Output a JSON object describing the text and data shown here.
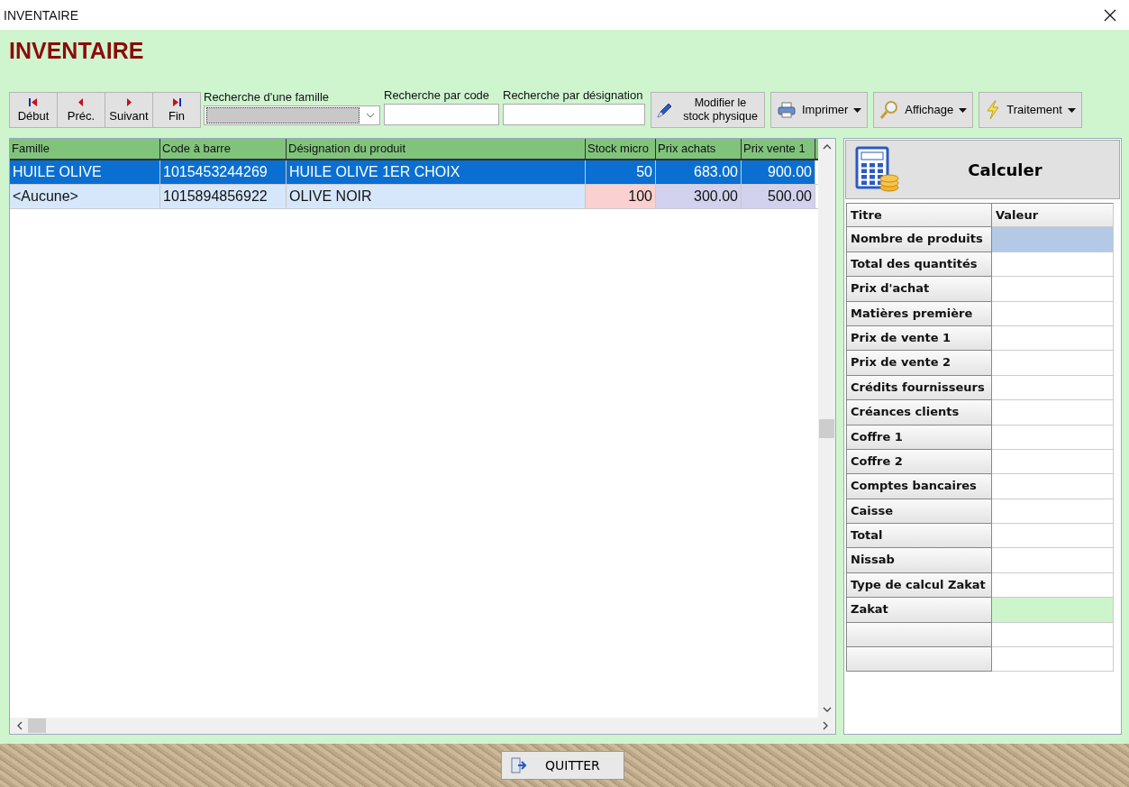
{
  "window": {
    "title": "INVENTAIRE"
  },
  "heading": "INVENTAIRE",
  "nav_buttons": [
    {
      "kind": "first",
      "label": "Début"
    },
    {
      "kind": "prev",
      "label": "Préc."
    },
    {
      "kind": "next",
      "label": "Suivant"
    },
    {
      "kind": "last",
      "label": "Fin"
    }
  ],
  "search": {
    "family_label": "Recherche d'une famille",
    "code_label": "Recherche par code",
    "designation_label": "Recherche par désignation"
  },
  "actions": [
    {
      "kind": "pen",
      "label": "Modifier le stock physique",
      "dropdown": false
    },
    {
      "kind": "printer",
      "label": "Imprimer",
      "dropdown": true
    },
    {
      "kind": "magnifier",
      "label": "Affichage",
      "dropdown": true
    },
    {
      "kind": "bolt",
      "label": "Traitement",
      "dropdown": true
    }
  ],
  "table": {
    "columns": [
      "Famille",
      "Code à barre",
      "Désignation du produit",
      "Stock micro",
      "Prix achats",
      "Prix vente 1"
    ],
    "rows": [
      {
        "selected": true,
        "cells": [
          "HUILE OLIVE",
          "1015453244269",
          "HUILE OLIVE 1ER CHOIX",
          "50",
          "683.00",
          "900.00"
        ]
      },
      {
        "selected": false,
        "cells": [
          "<Aucune>",
          "1015894856922",
          "OLIVE NOIR",
          "100",
          "300.00",
          "500.00"
        ]
      }
    ]
  },
  "calculate_button": "Calculer",
  "summary": {
    "columns": [
      "Titre",
      "Valeur"
    ],
    "rows": [
      {
        "title": "Nombre de produits",
        "color": "#b3c9e6"
      },
      {
        "title": "Total des quantités",
        "color": "#ffffff"
      },
      {
        "title": "Prix d'achat",
        "color": "#ffffff"
      },
      {
        "title": "Matières première",
        "color": "#ffffff"
      },
      {
        "title": "Prix de vente 1",
        "color": "#ffffff"
      },
      {
        "title": "Prix de vente 2",
        "color": "#ffffff"
      },
      {
        "title": "Crédits fournisseurs",
        "color": "#ffffff"
      },
      {
        "title": "Créances clients",
        "color": "#ffffff"
      },
      {
        "title": "Coffre 1",
        "color": "#ffffff"
      },
      {
        "title": "Coffre 2",
        "color": "#ffffff"
      },
      {
        "title": "Comptes bancaires",
        "color": "#ffffff"
      },
      {
        "title": "Caisse",
        "color": "#ffffff"
      },
      {
        "title": "Total",
        "color": "#ffffff"
      },
      {
        "title": "Nissab",
        "color": "#ffffff"
      },
      {
        "title": "Type de calcul Zakat",
        "color": "#ffffff"
      },
      {
        "title": "Zakat",
        "color": "#ccf5cc"
      },
      {
        "color": "#ffffff"
      },
      {
        "color": "#ffffff"
      }
    ]
  },
  "quit_button": "QUITTER"
}
